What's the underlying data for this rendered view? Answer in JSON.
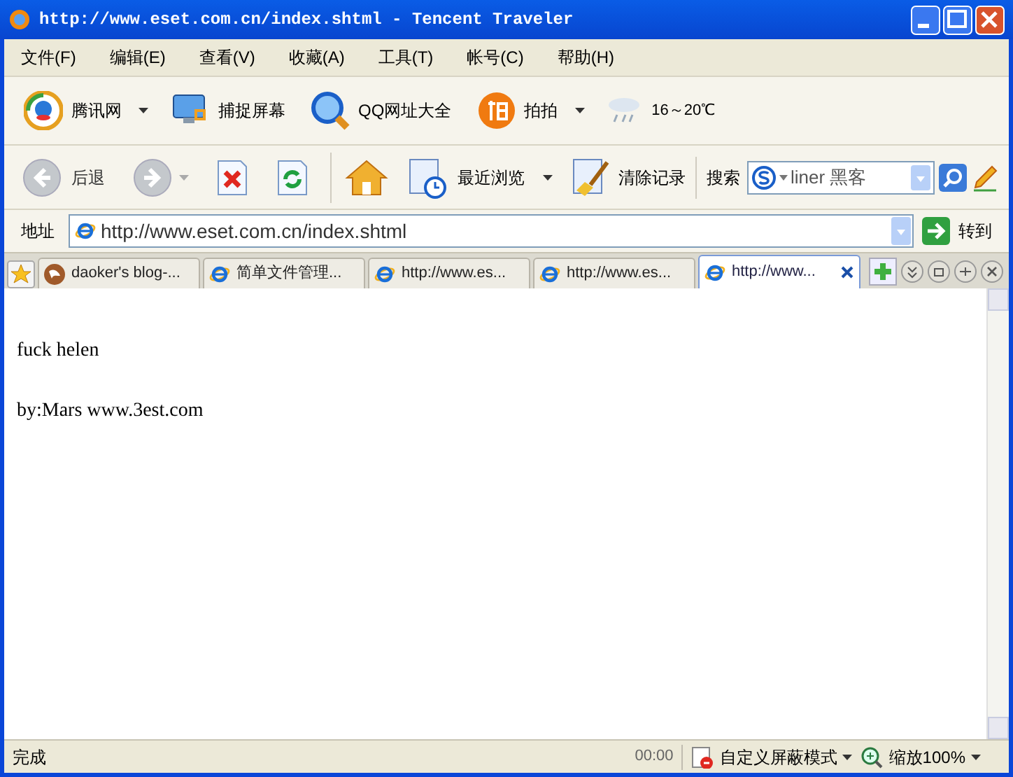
{
  "window": {
    "title": "http://www.eset.com.cn/index.shtml - Tencent Traveler"
  },
  "menu": [
    {
      "label": "文件(F)"
    },
    {
      "label": "编辑(E)"
    },
    {
      "label": "查看(V)"
    },
    {
      "label": "收藏(A)"
    },
    {
      "label": "工具(T)"
    },
    {
      "label": "帐号(C)"
    },
    {
      "label": "帮助(H)"
    }
  ],
  "links_bar": [
    {
      "label": "腾讯网",
      "dropdown": true
    },
    {
      "label": "捕捉屏幕",
      "dropdown": false
    },
    {
      "label": "QQ网址大全",
      "dropdown": false
    },
    {
      "label": "拍拍",
      "dropdown": true
    }
  ],
  "weather": "16～20℃",
  "nav_bar": {
    "back": {
      "label": "后退",
      "disabled": true
    },
    "forward": {
      "disabled": true
    },
    "recent": "最近浏览",
    "clear": "清除记录",
    "search_label": "搜索",
    "search_value": "liner 黑客"
  },
  "address_bar": {
    "label": "地址",
    "url": "http://www.eset.com.cn/index.shtml",
    "go": "转到"
  },
  "tabs": [
    {
      "label": "daoker's blog-...",
      "selected": false
    },
    {
      "label": "简单文件管理...",
      "selected": false
    },
    {
      "label": "http://www.es...",
      "selected": false
    },
    {
      "label": "http://www.es...",
      "selected": false
    },
    {
      "label": "http://www...",
      "selected": true
    }
  ],
  "page": {
    "paragraphs": [
      "fuck helen",
      "by:Mars www.3est.com"
    ]
  },
  "status_bar": {
    "status": "完成",
    "time": "00:00",
    "block_mode": "自定义屏蔽模式",
    "zoom": "缩放100%"
  }
}
